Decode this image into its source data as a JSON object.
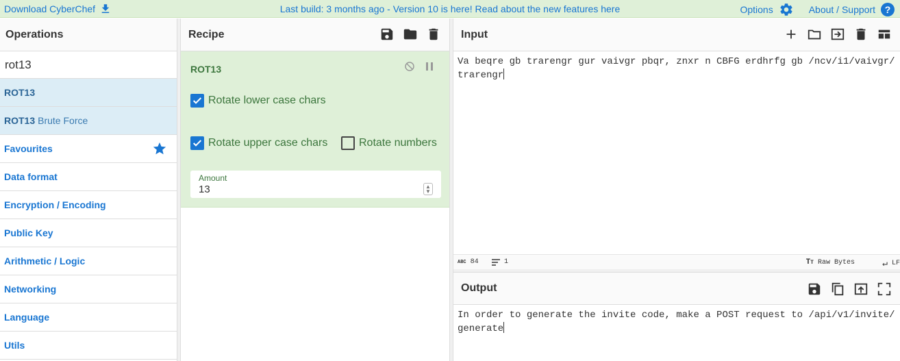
{
  "banner": {
    "download_label": "Download CyberChef",
    "build_notice": "Last build: 3 months ago - Version 10 is here! Read about the new features here",
    "options_label": "Options",
    "about_label": "About / Support",
    "about_icon_glyph": "?"
  },
  "operations": {
    "title": "Operations",
    "search_value": "rot13",
    "results": [
      {
        "match": "ROT13",
        "rest": ""
      },
      {
        "match": "ROT13",
        "rest": "Brute Force"
      }
    ],
    "categories": [
      "Favourites",
      "Data format",
      "Encryption / Encoding",
      "Public Key",
      "Arithmetic / Logic",
      "Networking",
      "Language",
      "Utils"
    ]
  },
  "recipe": {
    "title": "Recipe",
    "op_name": "ROT13",
    "options": {
      "rotate_lower": {
        "label": "Rotate lower case chars",
        "checked": true
      },
      "rotate_upper": {
        "label": "Rotate upper case chars",
        "checked": true
      },
      "rotate_numbers": {
        "label": "Rotate numbers",
        "checked": false
      }
    },
    "amount": {
      "label": "Amount",
      "value": "13"
    }
  },
  "input": {
    "title": "Input",
    "text": "Va beqre gb trarengr gur vaivgr pbqr, znxr n CBFG erdhrfg gb /ncv/i1/vaivgr/trarengr",
    "length": "84",
    "lines": "1",
    "encoding": "Raw Bytes",
    "eol": "LF"
  },
  "output": {
    "title": "Output",
    "text": "In order to generate the invite code, make a POST request to /api/v1/invite/generate"
  },
  "colors": {
    "accent": "#1976d2",
    "banner_bg": "#dff0d8",
    "recipe_bg": "#dff0d8",
    "recipe_text": "#3c763d",
    "highlight_bg": "#dcedf6"
  }
}
